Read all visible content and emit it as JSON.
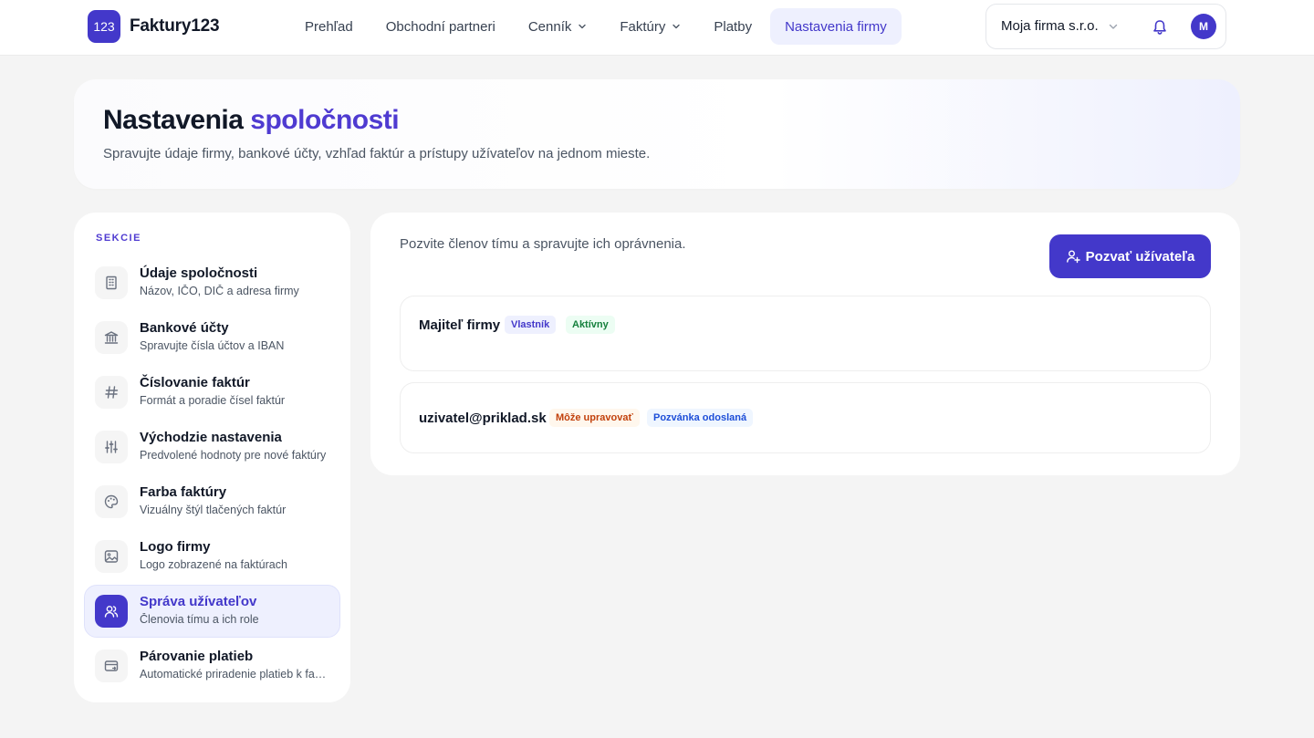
{
  "brand": {
    "badge": "123",
    "name": "Faktury123",
    "accent_color": "#4338ca"
  },
  "nav": {
    "items": [
      {
        "label": "Prehľad"
      },
      {
        "label": "Obchodní partneri"
      },
      {
        "label": "Cenník"
      },
      {
        "label": "Faktúry"
      },
      {
        "label": "Platby"
      },
      {
        "label": "Nastavenia firmy"
      }
    ]
  },
  "account": {
    "firm": "Moja firma s.r.o.",
    "avatar_initial": "M"
  },
  "hero": {
    "title_main": "Nastavenia",
    "title_accent": "spoločnosti",
    "subtitle": "Spravujte údaje firmy, bankové účty, vzhľad faktúr a prístupy užívateľov na jednom mieste."
  },
  "sidebar": {
    "section_label": "SEKCIE",
    "items": [
      {
        "title": "Údaje spoločnosti",
        "desc": "Názov, IČO, DIČ a adresa firmy",
        "icon": "building-icon"
      },
      {
        "title": "Bankové účty",
        "desc": "Spravujte čísla účtov a IBAN",
        "icon": "bank-icon"
      },
      {
        "title": "Číslovanie faktúr",
        "desc": "Formát a poradie čísel faktúr",
        "icon": "hash-icon"
      },
      {
        "title": "Východzie nastavenia",
        "desc": "Predvolené hodnoty pre nové faktúry",
        "icon": "sliders-icon"
      },
      {
        "title": "Farba faktúry",
        "desc": "Vizuálny štýl tlačených faktúr",
        "icon": "palette-icon"
      },
      {
        "title": "Logo firmy",
        "desc": "Logo zobrazené na faktúrach",
        "icon": "image-icon"
      },
      {
        "title": "Správa užívateľov",
        "desc": "Členovia tímu a ich role",
        "icon": "users-icon"
      },
      {
        "title": "Párovanie platieb",
        "desc": "Automatické priradenie platieb k faktúram",
        "icon": "card-icon"
      }
    ]
  },
  "panel": {
    "intro": "Pozvite členov tímu a spravujte ich oprávnenia.",
    "invite_label": "Pozvať užívateľa",
    "users": [
      {
        "name": "Majiteľ firmy",
        "role": "Vlastník",
        "status": "Aktívny"
      },
      {
        "name": "uzivatel@priklad.sk",
        "role": "Môže upravovať",
        "status": "Pozvánka odoslaná"
      }
    ]
  }
}
